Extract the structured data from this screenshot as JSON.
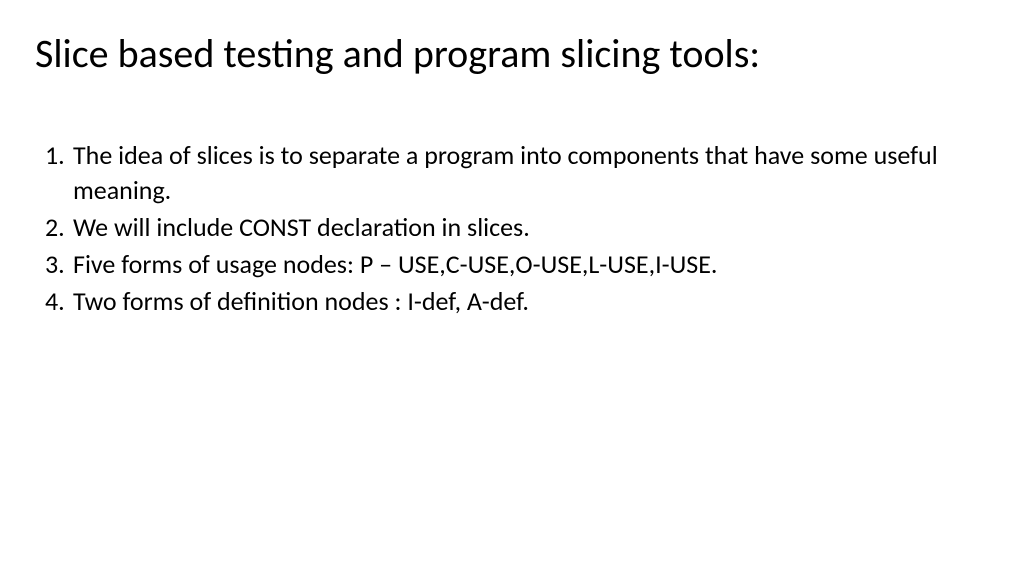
{
  "title": "Slice based testing and program slicing tools:",
  "items": [
    {
      "number": "1.",
      "text": "The idea of slices is to separate a program into components that have some useful meaning."
    },
    {
      "number": "2.",
      "text": "We will include CONST declaration in slices."
    },
    {
      "number": "3.",
      "text": "Five forms of usage nodes: P – USE,C-USE,O-USE,L-USE,I-USE."
    },
    {
      "number": "4.",
      "text": "Two forms of definition nodes : I-def, A-def."
    }
  ]
}
